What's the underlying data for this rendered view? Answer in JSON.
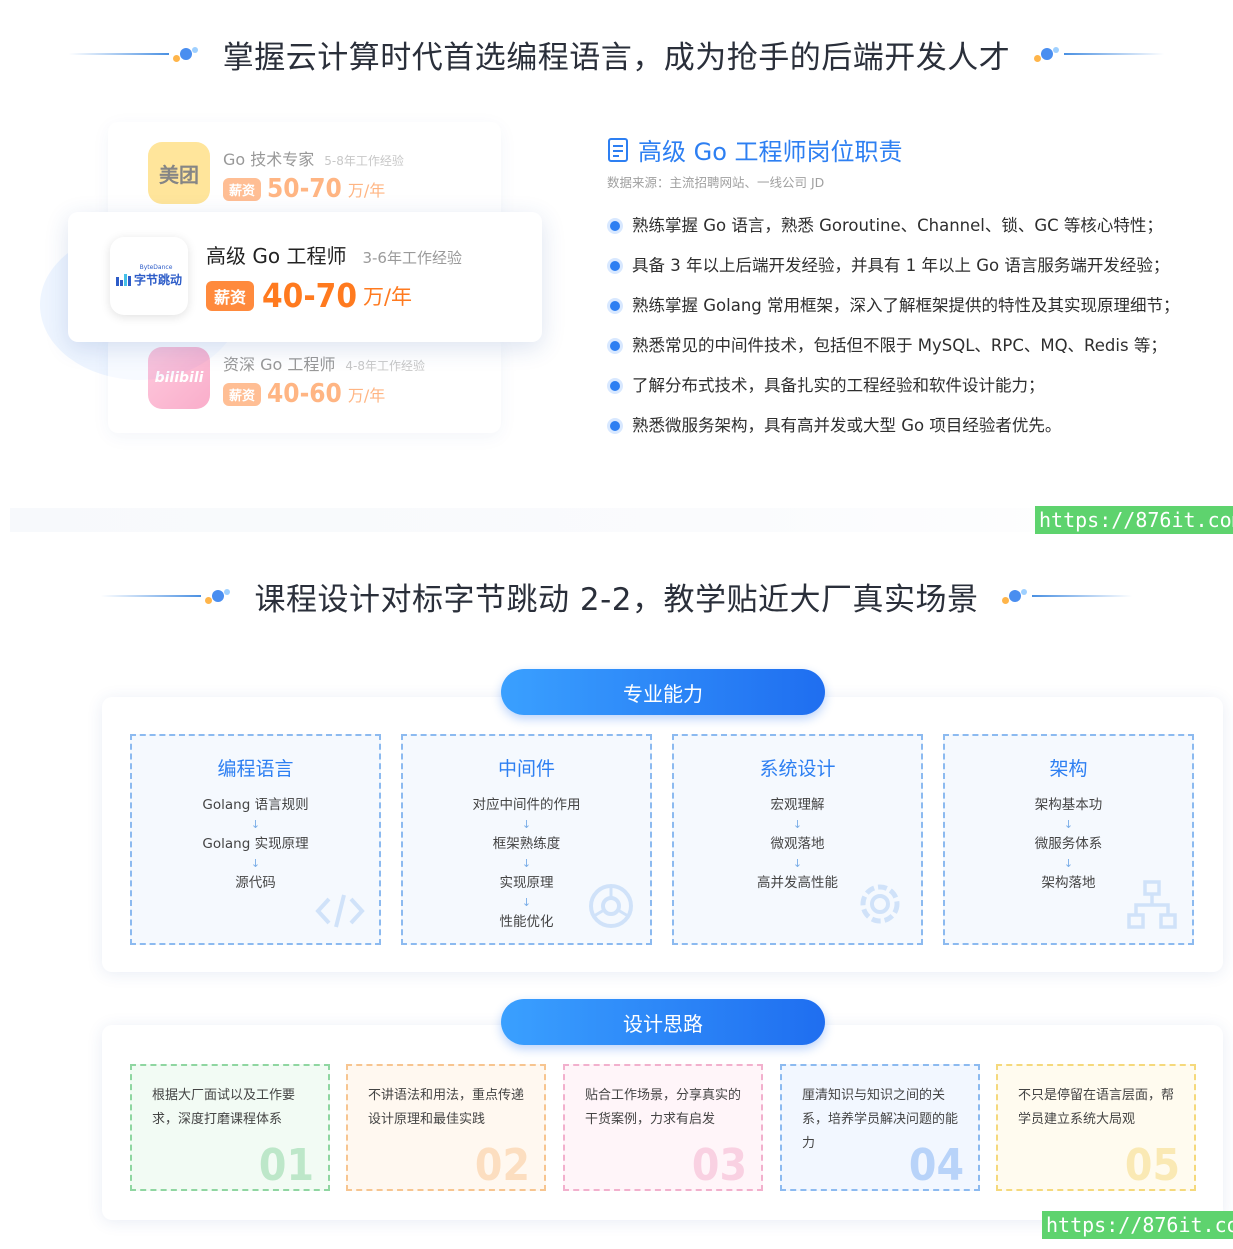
{
  "section1": {
    "title": "掌握云计算时代首选编程语言，成为抢手的后端开发人才"
  },
  "cards": [
    {
      "logo_text": "美团",
      "title": "Go 技术专家",
      "exp": "5-8年工作经验",
      "tag": "薪资",
      "salary": "50-70",
      "unit": "万/年"
    },
    {
      "logo_text": "字节跳动",
      "logo_sub": "ByteDance",
      "title": "高级 Go 工程师",
      "exp": "3-6年工作经验",
      "tag": "薪资",
      "salary": "40-70",
      "unit": "万/年"
    },
    {
      "logo_text": "bilibili",
      "title": "资深 Go 工程师",
      "exp": "4-8年工作经验",
      "tag": "薪资",
      "salary": "40-60",
      "unit": "万/年"
    }
  ],
  "duties": {
    "title": "高级 Go 工程师岗位职责",
    "source": "数据来源：主流招聘网站、一线公司 JD",
    "items": [
      "熟练掌握 Go 语言，熟悉 Goroutine、Channel、锁、GC 等核心特性；",
      "具备 3 年以上后端开发经验，并具有 1 年以上 Go 语言服务端开发经验；",
      "熟练掌握 Golang 常用框架，深入了解框架提供的特性及其实现原理细节；",
      "熟悉常见的中间件技术，包括但不限于 MySQL、RPC、MQ、Redis 等；",
      "了解分布式技术，具备扎实的工程经验和软件设计能力；",
      "熟悉微服务架构，具有高并发或大型 Go 项目经验者优先。"
    ]
  },
  "watermark": "https://876it.com",
  "section2": {
    "title": "课程设计对标字节跳动 2-2，教学贴近大厂真实场景"
  },
  "ability": {
    "label": "专业能力",
    "columns": [
      {
        "title": "编程语言",
        "items": [
          "Golang 语言规则",
          "Golang 实现原理",
          "源代码"
        ],
        "icon": "code-icon"
      },
      {
        "title": "中间件",
        "items": [
          "对应中间件的作用",
          "框架熟练度",
          "实现原理",
          "性能优化"
        ],
        "icon": "aperture-icon"
      },
      {
        "title": "系统设计",
        "items": [
          "宏观理解",
          "微观落地",
          "高并发高性能"
        ],
        "icon": "gear-icon"
      },
      {
        "title": "架构",
        "items": [
          "架构基本功",
          "微服务体系",
          "架构落地"
        ],
        "icon": "hierarchy-icon"
      }
    ],
    "arrow": "↓"
  },
  "design": {
    "label": "设计思路",
    "items": [
      {
        "text": "根据大厂面试以及工作要求，深度打磨课程体系",
        "num": "01",
        "color": "#5cc47a",
        "bg": "#f2fbf4"
      },
      {
        "text": "不讲语法和用法，重点传递设计原理和最佳实践",
        "num": "02",
        "color": "#f7b068",
        "bg": "#fff8f0"
      },
      {
        "text": "贴合工作场景，分享真实的干货案例，力求有启发",
        "num": "03",
        "color": "#ee8fb8",
        "bg": "#fff5f9"
      },
      {
        "text": "厘清知识与知识之间的关系，培养学员解决问题的能力",
        "num": "04",
        "color": "#4f93f0",
        "bg": "#f2f7ff"
      },
      {
        "text": "不只是停留在语言层面，帮学员建立系统大局观",
        "num": "05",
        "color": "#f3c948",
        "bg": "#fffbef"
      }
    ]
  }
}
